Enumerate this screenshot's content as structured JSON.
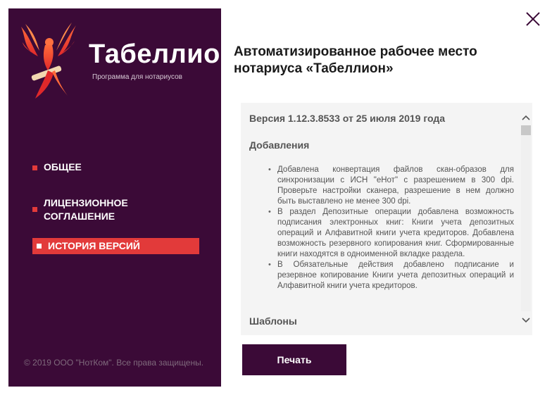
{
  "sidebar": {
    "brand_name": "Табеллион",
    "brand_subtitle": "Программа для нотариусов",
    "nav": [
      {
        "label": "ОБЩЕЕ",
        "active": false
      },
      {
        "label": "ЛИЦЕНЗИОННОЕ СОГЛАШЕНИЕ",
        "active": false
      },
      {
        "label": "ИСТОРИЯ ВЕРСИЙ",
        "active": true
      }
    ],
    "copyright": "© 2019 ООО \"НотКом\". Все права защищены."
  },
  "main": {
    "title": "Автоматизированное рабочее место нотариуса «Табеллион»",
    "version_heading": "Версия 1.12.3.8533 от 25 июля 2019 года",
    "additions_heading": "Добавления",
    "additions": [
      "Добавлена конвертация файлов скан-образов для синхронизации с ИСН \"еНот\" с разрешением в 300 dpi. Проверьте настройки сканера, разрешение в нем должно быть выставлено не менее 300 dpi.",
      "В раздел Депозитные операции добавлена возможность подписания электронных книг: Книги учета депозитных операций и Алфавитной книги учета кредиторов. Добавлена возможность резервного копирования книг. Сформированные книги находятся в одноименной вкладке раздела.",
      "В Обязательные действия добавлено подписание и резервное копирование Книги учета депозитных операций и Алфавитной книги учета кредиторов."
    ],
    "templates_heading": "Шаблоны",
    "print_label": "Печать"
  },
  "colors": {
    "sidebar_bg": "#3b0a37",
    "accent": "#e23a3a",
    "button_bg": "#3b0a37"
  },
  "icons": {
    "logo": "phoenix-logo-icon",
    "close": "close-icon",
    "scroll_up": "chevron-up-icon",
    "scroll_down": "chevron-down-icon"
  }
}
